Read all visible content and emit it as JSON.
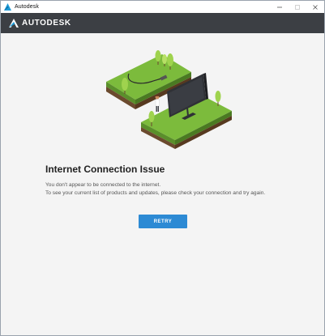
{
  "window": {
    "title": "Autodesk"
  },
  "header": {
    "brand": "AUTODESK"
  },
  "main": {
    "heading": "Internet Connection Issue",
    "message_line1": "You don't appear to be connected to the internet.",
    "message_line2": "To see your current list of products and updates, please check your connection and try again.",
    "retry_label": "RETRY"
  },
  "colors": {
    "accent": "#2d8ad4",
    "header_bg": "#3c3f44",
    "grass": "#7cbb3c",
    "soil": "#6b4a2e"
  },
  "icons": {
    "app": "autodesk-logo-icon",
    "minimize": "minimize-icon",
    "maximize": "maximize-icon",
    "close": "close-icon"
  }
}
